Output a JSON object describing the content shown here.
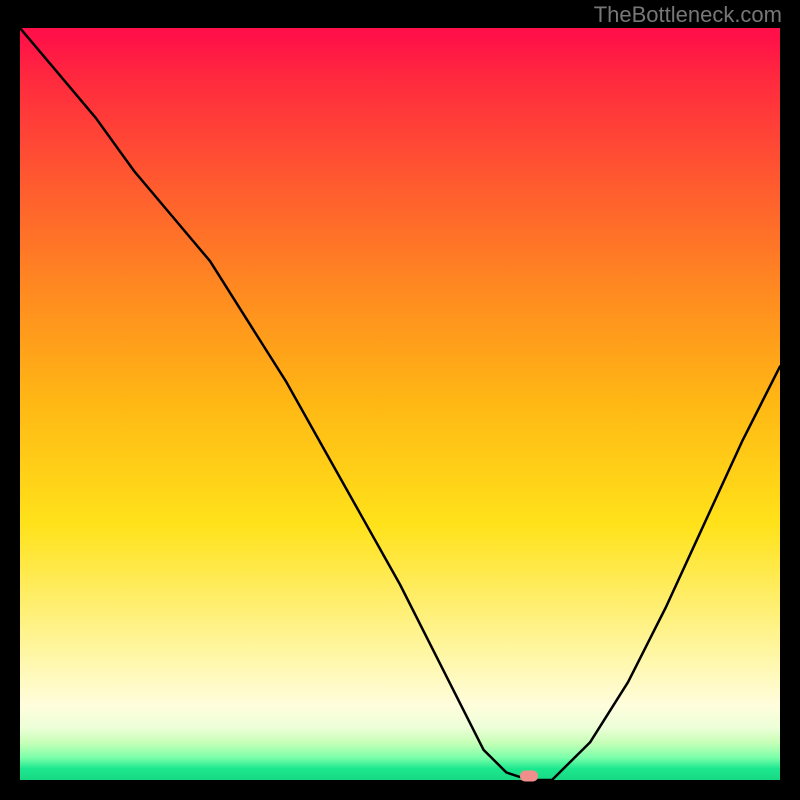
{
  "watermark": "TheBottleneck.com",
  "chart_data": {
    "type": "line",
    "title": "",
    "xlabel": "",
    "ylabel": "",
    "xlim": [
      0,
      100
    ],
    "ylim": [
      0,
      100
    ],
    "background_gradient": {
      "orientation": "vertical",
      "stops": [
        {
          "pos": 0,
          "color": "#ff1048"
        },
        {
          "pos": 7,
          "color": "#ff2a3e"
        },
        {
          "pos": 20,
          "color": "#ff5830"
        },
        {
          "pos": 35,
          "color": "#ff8a20"
        },
        {
          "pos": 50,
          "color": "#ffb814"
        },
        {
          "pos": 66,
          "color": "#ffe21a"
        },
        {
          "pos": 82,
          "color": "#fff59a"
        },
        {
          "pos": 90,
          "color": "#fffddc"
        },
        {
          "pos": 93,
          "color": "#edffd8"
        },
        {
          "pos": 95,
          "color": "#c8ffb8"
        },
        {
          "pos": 97,
          "color": "#7dffaa"
        },
        {
          "pos": 98.5,
          "color": "#1ce88e"
        },
        {
          "pos": 100,
          "color": "#18d884"
        }
      ]
    },
    "series": [
      {
        "name": "bottleneck-curve",
        "x": [
          0,
          5,
          10,
          15,
          20,
          25,
          30,
          35,
          40,
          45,
          50,
          55,
          58,
          61,
          64,
          67,
          70,
          75,
          80,
          85,
          90,
          95,
          100
        ],
        "y": [
          100,
          94,
          88,
          81,
          75,
          69,
          61,
          53,
          44,
          35,
          26,
          16,
          10,
          4,
          1,
          0,
          0,
          5,
          13,
          23,
          34,
          45,
          55
        ]
      }
    ],
    "marker": {
      "x": 67,
      "y": 0,
      "color": "#ef8e8a"
    }
  }
}
